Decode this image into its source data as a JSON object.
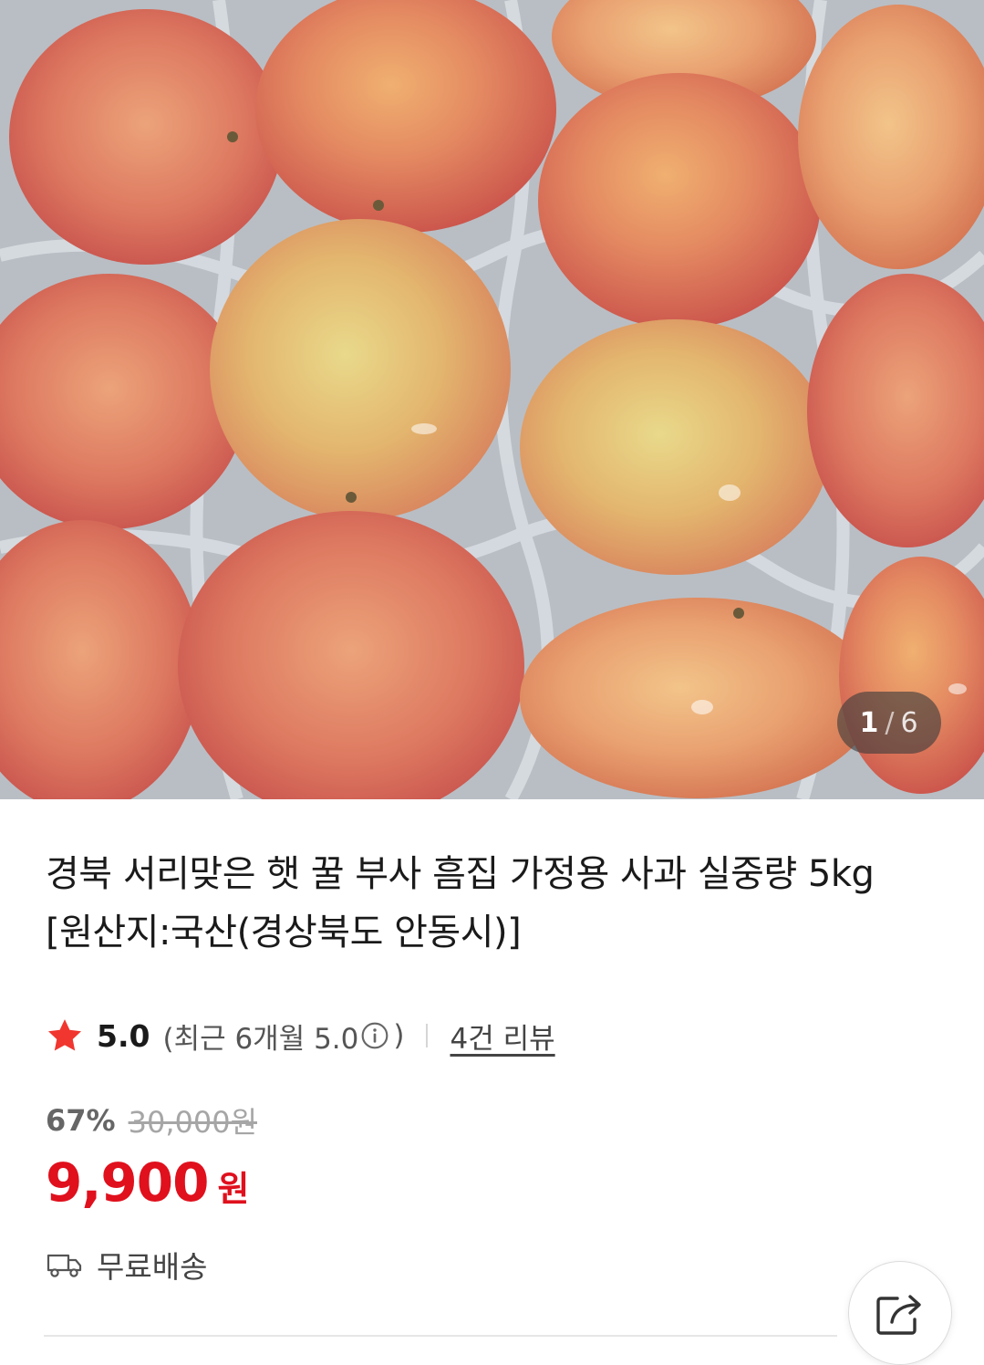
{
  "hero": {
    "alt_subject": "apples-in-box",
    "counter": {
      "current": "1",
      "separator": "/",
      "total": "6"
    }
  },
  "product": {
    "title": "경북 서리맞은 햇 꿀 부사 흠집 가정용 사과 실중량 5kg [원산지:국산(경상북도 안동시)]"
  },
  "rating": {
    "star_icon": "star-icon",
    "score": "5.0",
    "recent_prefix": "(최근 6개월 5.0",
    "recent_suffix": ")",
    "info_icon": "info-icon",
    "review_count": "4건 리뷰"
  },
  "price": {
    "discount": "67%",
    "original": "30,000원",
    "sale": "9,900",
    "sale_unit": "원"
  },
  "shipping": {
    "icon": "truck-icon",
    "label": "무료배송"
  },
  "share": {
    "icon": "share-icon"
  },
  "colors": {
    "sale_red": "#e0101d",
    "star_red": "#f0362f",
    "text_dark": "#1a1a1a",
    "text_gray": "#555555",
    "strike_gray": "#a6a6a6"
  }
}
